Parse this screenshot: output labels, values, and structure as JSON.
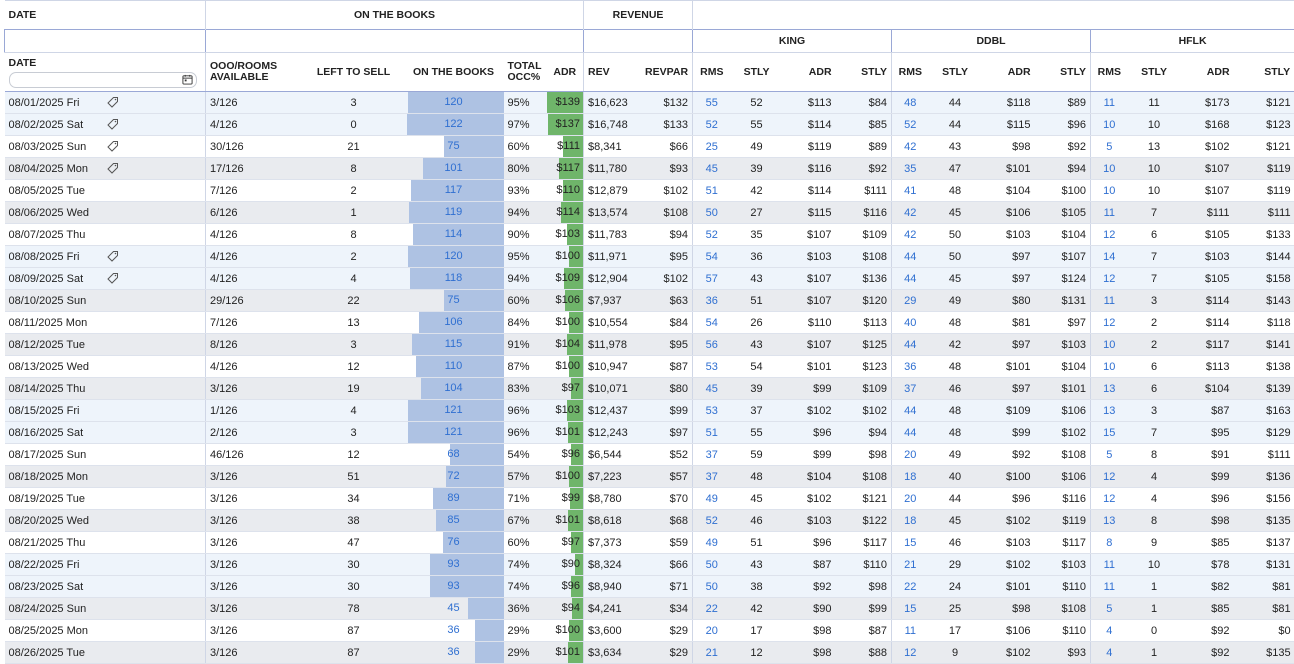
{
  "header": {
    "top": {
      "date": "DATE",
      "on_the_books": "ON THE BOOKS",
      "revenue": "REVENUE"
    },
    "groups": {
      "king": "KING",
      "ddbl": "DDBL",
      "hflk": "HFLK"
    },
    "cols": {
      "date": "DATE",
      "ooo_line1": "OOO/ROOMS",
      "ooo_line2": "AVAILABLE",
      "left": "LEFT TO SELL",
      "otb": "ON THE BOOKS",
      "occ_line1": "TOTAL",
      "occ_line2": "OCC%",
      "adr": "ADR",
      "rev": "REV",
      "revpar": "REVPAR",
      "rms": "RMS",
      "stly": "STLY"
    }
  },
  "colors": {
    "bar_otb": "#aec2e3",
    "bar_adr": "#6fb56a",
    "link": "#2f6fd1",
    "border": "#9aa8d6"
  },
  "rows": [
    {
      "date": "08/01/2025 Fri",
      "tag": true,
      "ooo": "3/126",
      "left": "3",
      "otb": "120",
      "otb_v": 120,
      "occ": "95%",
      "adr": "$139",
      "adr_v": 139,
      "rev": "$16,623",
      "revpar": "$132",
      "k": [
        "55",
        "52",
        "$113",
        "$84"
      ],
      "d": [
        "48",
        "44",
        "$118",
        "$89"
      ],
      "h": [
        "11",
        "11",
        "$173",
        "$121"
      ],
      "s": "hl"
    },
    {
      "date": "08/02/2025 Sat",
      "tag": true,
      "ooo": "4/126",
      "left": "0",
      "otb": "122",
      "otb_v": 122,
      "occ": "97%",
      "adr": "$137",
      "adr_v": 137,
      "rev": "$16,748",
      "revpar": "$133",
      "k": [
        "52",
        "55",
        "$114",
        "$85"
      ],
      "d": [
        "52",
        "44",
        "$115",
        "$96"
      ],
      "h": [
        "10",
        "10",
        "$168",
        "$123"
      ],
      "s": "hl"
    },
    {
      "date": "08/03/2025 Sun",
      "tag": true,
      "ooo": "30/126",
      "left": "21",
      "otb": "75",
      "otb_v": 75,
      "occ": "60%",
      "adr": "$111",
      "adr_v": 111,
      "rev": "$8,341",
      "revpar": "$66",
      "k": [
        "25",
        "49",
        "$119",
        "$89"
      ],
      "d": [
        "42",
        "43",
        "$98",
        "$92"
      ],
      "h": [
        "5",
        "13",
        "$102",
        "$121"
      ],
      "s": ""
    },
    {
      "date": "08/04/2025 Mon",
      "tag": true,
      "ooo": "17/126",
      "left": "8",
      "otb": "101",
      "otb_v": 101,
      "occ": "80%",
      "adr": "$117",
      "adr_v": 117,
      "rev": "$11,780",
      "revpar": "$93",
      "k": [
        "45",
        "39",
        "$116",
        "$92"
      ],
      "d": [
        "35",
        "47",
        "$101",
        "$94"
      ],
      "h": [
        "10",
        "10",
        "$107",
        "$119"
      ],
      "s": "alt"
    },
    {
      "date": "08/05/2025 Tue",
      "tag": false,
      "ooo": "7/126",
      "left": "2",
      "otb": "117",
      "otb_v": 117,
      "occ": "93%",
      "adr": "$110",
      "adr_v": 110,
      "rev": "$12,879",
      "revpar": "$102",
      "k": [
        "51",
        "42",
        "$114",
        "$111"
      ],
      "d": [
        "41",
        "48",
        "$104",
        "$100"
      ],
      "h": [
        "10",
        "10",
        "$107",
        "$119"
      ],
      "s": ""
    },
    {
      "date": "08/06/2025 Wed",
      "tag": false,
      "ooo": "6/126",
      "left": "1",
      "otb": "119",
      "otb_v": 119,
      "occ": "94%",
      "adr": "$114",
      "adr_v": 114,
      "rev": "$13,574",
      "revpar": "$108",
      "k": [
        "50",
        "27",
        "$115",
        "$116"
      ],
      "d": [
        "42",
        "45",
        "$106",
        "$105"
      ],
      "h": [
        "11",
        "7",
        "$111",
        "$111"
      ],
      "s": "alt"
    },
    {
      "date": "08/07/2025 Thu",
      "tag": false,
      "ooo": "4/126",
      "left": "8",
      "otb": "114",
      "otb_v": 114,
      "occ": "90%",
      "adr": "$103",
      "adr_v": 103,
      "rev": "$11,783",
      "revpar": "$94",
      "k": [
        "52",
        "35",
        "$107",
        "$109"
      ],
      "d": [
        "42",
        "50",
        "$103",
        "$104"
      ],
      "h": [
        "12",
        "6",
        "$105",
        "$133"
      ],
      "s": ""
    },
    {
      "date": "08/08/2025 Fri",
      "tag": true,
      "ooo": "4/126",
      "left": "2",
      "otb": "120",
      "otb_v": 120,
      "occ": "95%",
      "adr": "$100",
      "adr_v": 100,
      "rev": "$11,971",
      "revpar": "$95",
      "k": [
        "54",
        "36",
        "$103",
        "$108"
      ],
      "d": [
        "44",
        "50",
        "$97",
        "$107"
      ],
      "h": [
        "14",
        "7",
        "$103",
        "$144"
      ],
      "s": "hl"
    },
    {
      "date": "08/09/2025 Sat",
      "tag": true,
      "ooo": "4/126",
      "left": "4",
      "otb": "118",
      "otb_v": 118,
      "occ": "94%",
      "adr": "$109",
      "adr_v": 109,
      "rev": "$12,904",
      "revpar": "$102",
      "k": [
        "57",
        "43",
        "$107",
        "$136"
      ],
      "d": [
        "44",
        "45",
        "$97",
        "$124"
      ],
      "h": [
        "12",
        "7",
        "$105",
        "$158"
      ],
      "s": "hl"
    },
    {
      "date": "08/10/2025 Sun",
      "tag": false,
      "ooo": "29/126",
      "left": "22",
      "otb": "75",
      "otb_v": 75,
      "occ": "60%",
      "adr": "$106",
      "adr_v": 106,
      "rev": "$7,937",
      "revpar": "$63",
      "k": [
        "36",
        "51",
        "$107",
        "$120"
      ],
      "d": [
        "29",
        "49",
        "$80",
        "$131"
      ],
      "h": [
        "11",
        "3",
        "$114",
        "$143"
      ],
      "s": "alt"
    },
    {
      "date": "08/11/2025 Mon",
      "tag": false,
      "ooo": "7/126",
      "left": "13",
      "otb": "106",
      "otb_v": 106,
      "occ": "84%",
      "adr": "$100",
      "adr_v": 100,
      "rev": "$10,554",
      "revpar": "$84",
      "k": [
        "54",
        "26",
        "$110",
        "$113"
      ],
      "d": [
        "40",
        "48",
        "$81",
        "$97"
      ],
      "h": [
        "12",
        "2",
        "$114",
        "$118"
      ],
      "s": ""
    },
    {
      "date": "08/12/2025 Tue",
      "tag": false,
      "ooo": "8/126",
      "left": "3",
      "otb": "115",
      "otb_v": 115,
      "occ": "91%",
      "adr": "$104",
      "adr_v": 104,
      "rev": "$11,978",
      "revpar": "$95",
      "k": [
        "56",
        "43",
        "$107",
        "$125"
      ],
      "d": [
        "44",
        "42",
        "$97",
        "$103"
      ],
      "h": [
        "10",
        "2",
        "$117",
        "$141"
      ],
      "s": "alt"
    },
    {
      "date": "08/13/2025 Wed",
      "tag": false,
      "ooo": "4/126",
      "left": "12",
      "otb": "110",
      "otb_v": 110,
      "occ": "87%",
      "adr": "$100",
      "adr_v": 100,
      "rev": "$10,947",
      "revpar": "$87",
      "k": [
        "53",
        "54",
        "$101",
        "$123"
      ],
      "d": [
        "36",
        "48",
        "$101",
        "$104"
      ],
      "h": [
        "10",
        "6",
        "$113",
        "$138"
      ],
      "s": ""
    },
    {
      "date": "08/14/2025 Thu",
      "tag": false,
      "ooo": "3/126",
      "left": "19",
      "otb": "104",
      "otb_v": 104,
      "occ": "83%",
      "adr": "$97",
      "adr_v": 97,
      "rev": "$10,071",
      "revpar": "$80",
      "k": [
        "45",
        "39",
        "$99",
        "$109"
      ],
      "d": [
        "37",
        "46",
        "$97",
        "$101"
      ],
      "h": [
        "13",
        "6",
        "$104",
        "$139"
      ],
      "s": "alt"
    },
    {
      "date": "08/15/2025 Fri",
      "tag": false,
      "ooo": "1/126",
      "left": "4",
      "otb": "121",
      "otb_v": 121,
      "occ": "96%",
      "adr": "$103",
      "adr_v": 103,
      "rev": "$12,437",
      "revpar": "$99",
      "k": [
        "53",
        "37",
        "$102",
        "$102"
      ],
      "d": [
        "44",
        "48",
        "$109",
        "$106"
      ],
      "h": [
        "13",
        "3",
        "$87",
        "$163"
      ],
      "s": "hl"
    },
    {
      "date": "08/16/2025 Sat",
      "tag": false,
      "ooo": "2/126",
      "left": "3",
      "otb": "121",
      "otb_v": 121,
      "occ": "96%",
      "adr": "$101",
      "adr_v": 101,
      "rev": "$12,243",
      "revpar": "$97",
      "k": [
        "51",
        "55",
        "$96",
        "$94"
      ],
      "d": [
        "44",
        "48",
        "$99",
        "$102"
      ],
      "h": [
        "15",
        "7",
        "$95",
        "$129"
      ],
      "s": "hl"
    },
    {
      "date": "08/17/2025 Sun",
      "tag": false,
      "ooo": "46/126",
      "left": "12",
      "otb": "68",
      "otb_v": 68,
      "occ": "54%",
      "adr": "$96",
      "adr_v": 96,
      "rev": "$6,544",
      "revpar": "$52",
      "k": [
        "37",
        "59",
        "$99",
        "$98"
      ],
      "d": [
        "20",
        "49",
        "$92",
        "$108"
      ],
      "h": [
        "5",
        "8",
        "$91",
        "$111"
      ],
      "s": ""
    },
    {
      "date": "08/18/2025 Mon",
      "tag": false,
      "ooo": "3/126",
      "left": "51",
      "otb": "72",
      "otb_v": 72,
      "occ": "57%",
      "adr": "$100",
      "adr_v": 100,
      "rev": "$7,223",
      "revpar": "$57",
      "k": [
        "37",
        "48",
        "$104",
        "$108"
      ],
      "d": [
        "18",
        "40",
        "$100",
        "$106"
      ],
      "h": [
        "12",
        "4",
        "$99",
        "$136"
      ],
      "s": "alt"
    },
    {
      "date": "08/19/2025 Tue",
      "tag": false,
      "ooo": "3/126",
      "left": "34",
      "otb": "89",
      "otb_v": 89,
      "occ": "71%",
      "adr": "$99",
      "adr_v": 99,
      "rev": "$8,780",
      "revpar": "$70",
      "k": [
        "49",
        "45",
        "$102",
        "$121"
      ],
      "d": [
        "20",
        "44",
        "$96",
        "$116"
      ],
      "h": [
        "12",
        "4",
        "$96",
        "$156"
      ],
      "s": ""
    },
    {
      "date": "08/20/2025 Wed",
      "tag": false,
      "ooo": "3/126",
      "left": "38",
      "otb": "85",
      "otb_v": 85,
      "occ": "67%",
      "adr": "$101",
      "adr_v": 101,
      "rev": "$8,618",
      "revpar": "$68",
      "k": [
        "52",
        "46",
        "$103",
        "$122"
      ],
      "d": [
        "18",
        "45",
        "$102",
        "$119"
      ],
      "h": [
        "13",
        "8",
        "$98",
        "$135"
      ],
      "s": "alt"
    },
    {
      "date": "08/21/2025 Thu",
      "tag": false,
      "ooo": "3/126",
      "left": "47",
      "otb": "76",
      "otb_v": 76,
      "occ": "60%",
      "adr": "$97",
      "adr_v": 97,
      "rev": "$7,373",
      "revpar": "$59",
      "k": [
        "49",
        "51",
        "$96",
        "$117"
      ],
      "d": [
        "15",
        "46",
        "$103",
        "$117"
      ],
      "h": [
        "8",
        "9",
        "$85",
        "$137"
      ],
      "s": ""
    },
    {
      "date": "08/22/2025 Fri",
      "tag": false,
      "ooo": "3/126",
      "left": "30",
      "otb": "93",
      "otb_v": 93,
      "occ": "74%",
      "adr": "$90",
      "adr_v": 90,
      "rev": "$8,324",
      "revpar": "$66",
      "k": [
        "50",
        "43",
        "$87",
        "$110"
      ],
      "d": [
        "21",
        "29",
        "$102",
        "$103"
      ],
      "h": [
        "11",
        "10",
        "$78",
        "$131"
      ],
      "s": "hl"
    },
    {
      "date": "08/23/2025 Sat",
      "tag": false,
      "ooo": "3/126",
      "left": "30",
      "otb": "93",
      "otb_v": 93,
      "occ": "74%",
      "adr": "$96",
      "adr_v": 96,
      "rev": "$8,940",
      "revpar": "$71",
      "k": [
        "50",
        "38",
        "$92",
        "$98"
      ],
      "d": [
        "22",
        "24",
        "$101",
        "$110"
      ],
      "h": [
        "11",
        "1",
        "$82",
        "$81"
      ],
      "s": "hl"
    },
    {
      "date": "08/24/2025 Sun",
      "tag": false,
      "ooo": "3/126",
      "left": "78",
      "otb": "45",
      "otb_v": 45,
      "occ": "36%",
      "adr": "$94",
      "adr_v": 94,
      "rev": "$4,241",
      "revpar": "$34",
      "k": [
        "22",
        "42",
        "$90",
        "$99"
      ],
      "d": [
        "15",
        "25",
        "$98",
        "$108"
      ],
      "h": [
        "5",
        "1",
        "$85",
        "$81"
      ],
      "s": "alt"
    },
    {
      "date": "08/25/2025 Mon",
      "tag": false,
      "ooo": "3/126",
      "left": "87",
      "otb": "36",
      "otb_v": 36,
      "occ": "29%",
      "adr": "$100",
      "adr_v": 100,
      "rev": "$3,600",
      "revpar": "$29",
      "k": [
        "20",
        "17",
        "$98",
        "$87"
      ],
      "d": [
        "11",
        "17",
        "$106",
        "$110"
      ],
      "h": [
        "4",
        "0",
        "$92",
        "$0"
      ],
      "s": ""
    },
    {
      "date": "08/26/2025 Tue",
      "tag": false,
      "ooo": "3/126",
      "left": "87",
      "otb": "36",
      "otb_v": 36,
      "occ": "29%",
      "adr": "$101",
      "adr_v": 101,
      "rev": "$3,634",
      "revpar": "$29",
      "k": [
        "21",
        "12",
        "$98",
        "$88"
      ],
      "d": [
        "12",
        "9",
        "$102",
        "$93"
      ],
      "h": [
        "4",
        "1",
        "$92",
        "$135"
      ],
      "s": "alt"
    }
  ]
}
